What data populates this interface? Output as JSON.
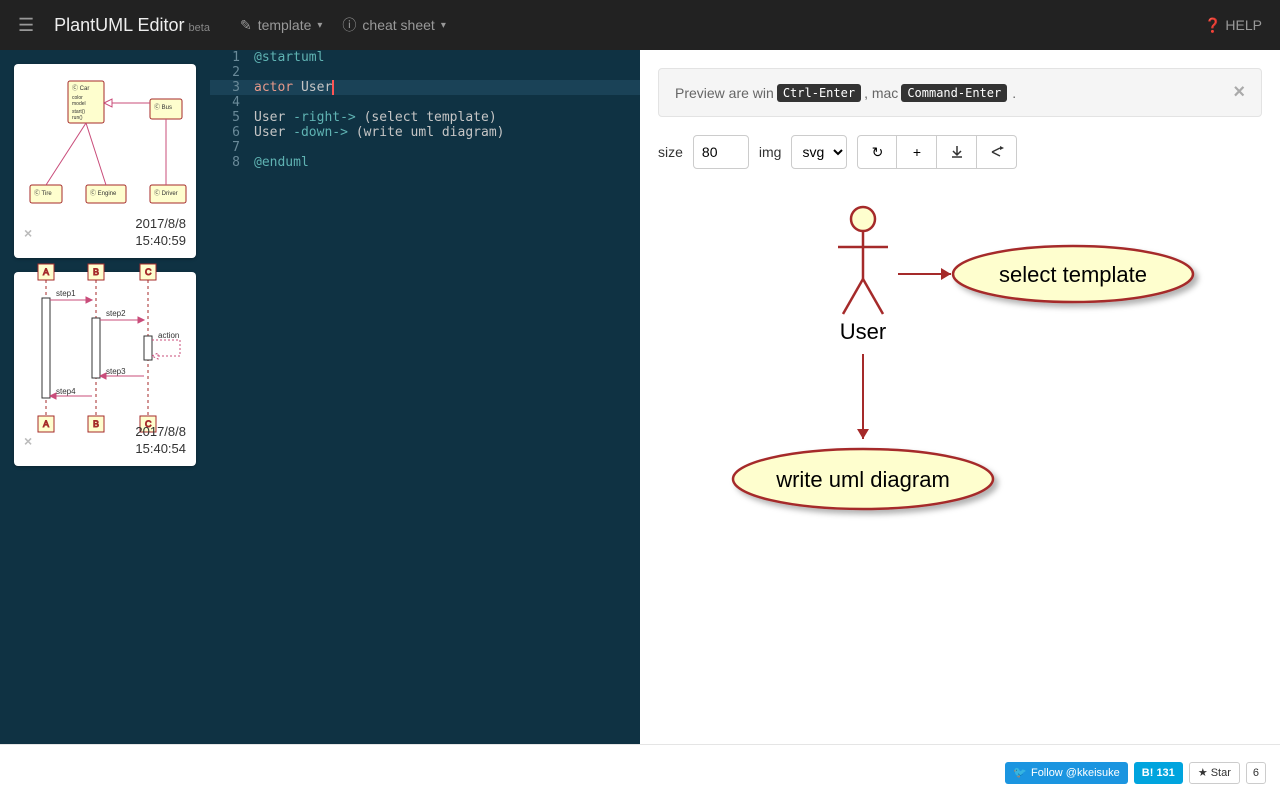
{
  "navbar": {
    "brand": "PlantUML Editor",
    "beta": "beta",
    "template_label": "template",
    "cheatsheet_label": "cheat sheet",
    "help_label": "HELP"
  },
  "thumbnails": [
    {
      "date": "2017/8/8",
      "time": "15:40:59"
    },
    {
      "date": "2017/8/8",
      "time": "15:40:54"
    }
  ],
  "editor": {
    "lines": [
      {
        "n": 1,
        "raw": "@startuml"
      },
      {
        "n": 2,
        "raw": ""
      },
      {
        "n": 3,
        "raw": "actor User"
      },
      {
        "n": 4,
        "raw": ""
      },
      {
        "n": 5,
        "raw": "User -right-> (select template)"
      },
      {
        "n": 6,
        "raw": "User -down-> (write uml diagram)"
      },
      {
        "n": 7,
        "raw": ""
      },
      {
        "n": 8,
        "raw": "@enduml"
      }
    ],
    "active_line": 3
  },
  "preview": {
    "hint_prefix": "Preview are win",
    "hint_kbd1": "Ctrl-Enter",
    "hint_mid": ", mac",
    "hint_kbd2": "Command-Enter",
    "hint_suffix": ".",
    "size_label": "size",
    "size_value": "80",
    "img_label": "img",
    "img_value": "svg",
    "diagram": {
      "actor_label": "User",
      "usecase_right": "select template",
      "usecase_down": "write uml diagram"
    }
  },
  "footer": {
    "twitter": "Follow @kkeisuke",
    "hatena": "B! 131",
    "star": "Star",
    "star_count": "6"
  }
}
